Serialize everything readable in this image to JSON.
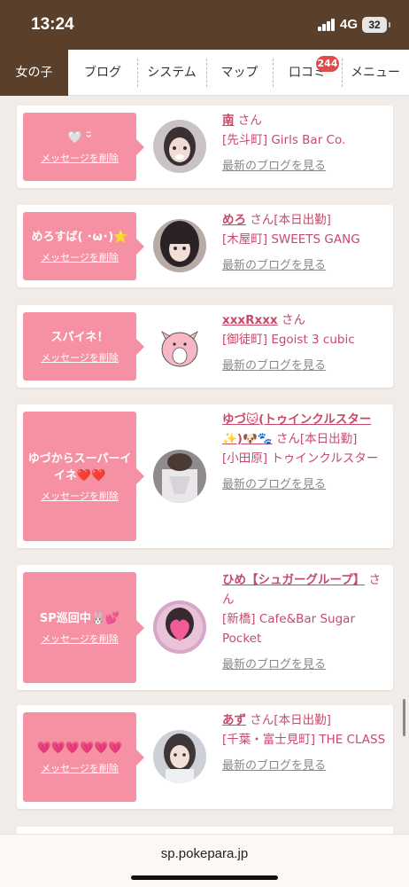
{
  "status_bar": {
    "time": "13:24",
    "network": "4G",
    "battery": "32"
  },
  "tabs": [
    {
      "label": "女の子",
      "active": true
    },
    {
      "label": "ブログ"
    },
    {
      "label": "システム"
    },
    {
      "label": "マップ"
    },
    {
      "label": "口コミ",
      "badge": "244"
    },
    {
      "label": "メニュー"
    }
  ],
  "cards": [
    {
      "message": "🤍 ᵕ̈ ",
      "delete_label": "メッセージを削除",
      "name": "南",
      "san": "さん",
      "extra": "",
      "shop": "[先斗町] Girls Bar Co.",
      "blog_link": "最新のブログを見る"
    },
    {
      "message": "めろすば( ･ω･)⭐️",
      "delete_label": "メッセージを削除",
      "name": "めろ",
      "san": "さん",
      "extra": "[本日出勤]",
      "shop": "[木屋町] SWEETS GANG",
      "blog_link": "最新のブログを見る"
    },
    {
      "message": "スパイネ！",
      "delete_label": "メッセージを削除",
      "name": "xxxRxxx",
      "san": "さん",
      "extra": "",
      "shop": "[御徒町] Egoist 3 cubic",
      "blog_link": "最新のブログを見る"
    },
    {
      "message": "ゆづからスーパーイイネ❤️❤️",
      "delete_label": "メッセージを削除",
      "name": "ゆづ🐱(トゥインクルスター✨)🐶🐾",
      "san": "さん",
      "extra": "[本日出勤]",
      "shop": "[小田原] トゥインクルスター",
      "blog_link": "最新のブログを見る"
    },
    {
      "message": "SP巡回中🐰💕",
      "delete_label": "メッセージを削除",
      "name": "ひめ【シュガーグループ】",
      "san": "さん",
      "extra": "",
      "shop": "[新橋] Cafe&Bar Sugar Pocket",
      "blog_link": "最新のブログを見る"
    },
    {
      "message": "💗💗💗💗💗💗",
      "delete_label": "メッセージを削除",
      "name": "あず",
      "san": "さん",
      "extra": "[本日出勤]",
      "shop": "[千葉・富士見町] THE CLASS",
      "blog_link": "最新のブログを見る"
    }
  ],
  "browser": {
    "url": "sp.pokepara.jp"
  },
  "colors": {
    "brown": "#5a3f2a",
    "pink": "#f691a3",
    "name_pink": "#c74a6b",
    "badge_red": "#e04a4a"
  }
}
